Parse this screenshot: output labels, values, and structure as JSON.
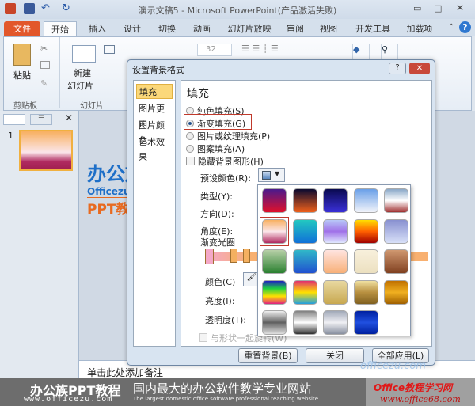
{
  "window": {
    "title": "演示文稿5 - Microsoft PowerPoint(产品激活失败)"
  },
  "tabs": [
    "文件",
    "开始",
    "插入",
    "设计",
    "切换",
    "动画",
    "幻灯片放映",
    "审阅",
    "视图",
    "开发工具",
    "加载项"
  ],
  "ribbon": {
    "paste": "粘贴",
    "new_slide_line1": "新建",
    "new_slide_line2": "幻灯片",
    "font_size": "32",
    "group_clipboard": "剪贴板",
    "group_slides": "幻灯片"
  },
  "slide_panel": {
    "slide_number": "1"
  },
  "notes": {
    "placeholder": "单击此处添加备注"
  },
  "dialog": {
    "title": "设置背景格式",
    "help": "?",
    "close": "✕",
    "categories": [
      "填充",
      "图片更正",
      "图片颜色",
      "艺术效果"
    ],
    "section_title": "填充",
    "options": [
      "纯色填充(S)",
      "渐变填充(G)",
      "图片或纹理填充(P)",
      "图案填充(A)"
    ],
    "selected_option": 1,
    "hide_graphics": "隐藏背景图形(H)",
    "preset_label": "预设颜色(R):",
    "type_label": "类型(Y):",
    "direction_label": "方向(D):",
    "angle_label": "角度(E):",
    "stops_label": "渐变光圈",
    "color_label": "颜色(C)",
    "brightness_label": "亮度(I):",
    "transparency_label": "透明度(T):",
    "rotate_with_shape": "与形状一起旋转(W)",
    "buttons": {
      "reset": "重置背景(B)",
      "close": "关闭",
      "apply_all": "全部应用(L)"
    }
  },
  "gallery": {
    "selected": 5,
    "presets": [
      [
        "#4a1a8c",
        "#e0102a"
      ],
      [
        "#0a0a30",
        "#f0601a"
      ],
      [
        "#0a0a50",
        "#3a30d8"
      ],
      [
        "#6aa0e8",
        "#f2f4fa"
      ],
      [
        "#8aa8c8",
        "#ffffff",
        "#a03030"
      ],
      [
        "#f8b060",
        "#fbe6ea",
        "#b02a60"
      ],
      [
        "#22c8c0",
        "#1070d8"
      ],
      [
        "#b8c8f8",
        "#a070e8",
        "#e0e8ff"
      ],
      [
        "#ffe000",
        "#ff6000",
        "#a00000"
      ],
      [
        "#8890d0",
        "#d8e0f8"
      ],
      [
        "#b8d0a8",
        "#2a8030"
      ],
      [
        "#30b8c8",
        "#2050d0"
      ],
      [
        "#ffe4e0",
        "#f8b078"
      ],
      [
        "#f8f0dc",
        "#ece0c0"
      ],
      [
        "#d09870",
        "#804020"
      ],
      [
        "#2020c0",
        "#20d040",
        "#ffe000",
        "#e02080"
      ],
      [
        "#e03070",
        "#ffe000",
        "#20a0e0"
      ],
      [
        "#e8d8a0",
        "#c8a850"
      ],
      [
        "#f0e0a0",
        "#b89040",
        "#806020"
      ],
      [
        "#c07000",
        "#f0b020",
        "#a06000"
      ],
      [
        "#f0f0f0",
        "#606060",
        "#e0e0e0"
      ],
      [
        "#808080",
        "#ffffff",
        "#303030"
      ],
      [
        "#a0a8b8",
        "#f0f0f4",
        "#8890a0"
      ],
      [
        "#0020a0",
        "#2050e0",
        "#0020a0"
      ]
    ]
  },
  "watermark": {
    "logo_cn": "办公族",
    "logo_url": "Officezu.com",
    "logo_ppt": "PPT教程",
    "corner_url": "officezu.com"
  },
  "footer": {
    "brand": "办公族PPT教程",
    "url": "www.officezu.com",
    "slogan": "国内最大的办公软件教学专业网站",
    "slogan_en": "The largest domestic office software professional teaching website .",
    "badge_title": "Office教程学习网",
    "badge_url": "www.office68.com"
  }
}
